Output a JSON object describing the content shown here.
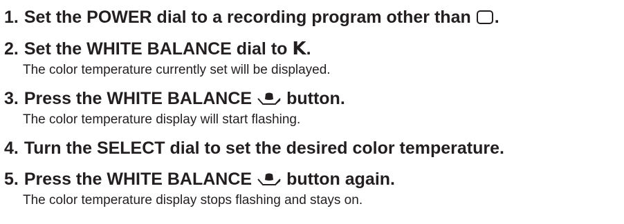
{
  "steps": [
    {
      "number": "1.",
      "text_before": "Set the POWER dial to a recording program other than",
      "icon": "rounded-rectangle-mode-icon",
      "text_after": "."
    },
    {
      "number": "2.",
      "text_before": "Set the WHITE BALANCE dial to",
      "symbol": "K",
      "text_after": ".",
      "note": "The color temperature currently set will be displayed."
    },
    {
      "number": "3.",
      "text_before": "Press the WHITE BALANCE",
      "icon": "white-balance-set-icon",
      "text_after": "button.",
      "note": "The color temperature display will start flashing."
    },
    {
      "number": "4.",
      "text": "Turn the SELECT dial to set the desired color temperature."
    },
    {
      "number": "5.",
      "text_before": "Press the WHITE BALANCE",
      "icon": "white-balance-set-icon",
      "text_after": "button again.",
      "note": "The color temperature display stops flashing and stays on."
    }
  ],
  "colors": {
    "text": "#231f20",
    "background": "#ffffff"
  }
}
